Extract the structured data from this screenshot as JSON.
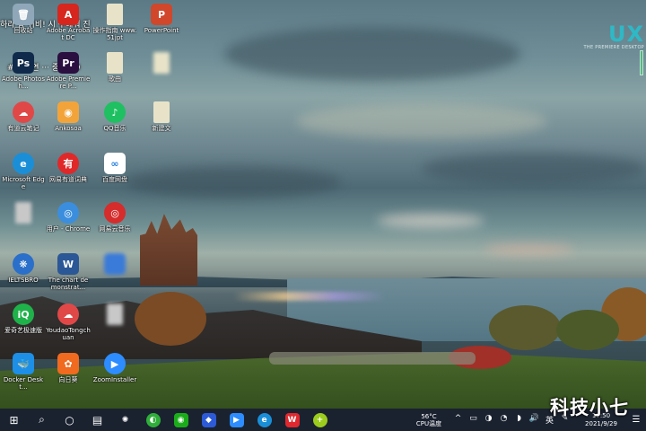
{
  "watermark": {
    "brand": "UX",
    "tagline": "THE PREMIERE DESKTOP",
    "corner_text": "科技小七"
  },
  "overlay": {
    "line1": "하라 왕 쉬비! 시 구해줘 진",
    "line2": "# 8화 연 ··· 중 UHD"
  },
  "icons": [
    {
      "name": "recycle-bin",
      "label": "回收站",
      "glyph": "🗑",
      "color": "#8fa7b8"
    },
    {
      "name": "adobe-acrobat",
      "label": "Adobe Acrobat DC",
      "glyph": "A",
      "color": "#d7261e"
    },
    {
      "name": "file-51jpt",
      "label": "操作指南 www.51jpt",
      "glyph": "",
      "color": "#e8e3c8"
    },
    {
      "name": "powerpoint",
      "label": "PowerPoint",
      "glyph": "P",
      "color": "#d0472b"
    },
    {
      "name": "photoshop",
      "label": "Adobe Photosh...",
      "glyph": "Ps",
      "color": "#0f2a4a"
    },
    {
      "name": "premiere",
      "label": "Adobe Premiere P...",
      "glyph": "Pr",
      "color": "#2a0f40"
    },
    {
      "name": "file-2",
      "label": "歌曲",
      "glyph": "",
      "color": "#e8e3c8"
    },
    {
      "name": "file-3",
      "label": "",
      "glyph": "",
      "color": "#e8e3c8"
    },
    {
      "name": "cloud-app",
      "label": "有道云笔记",
      "glyph": "☁",
      "color": "#e04848"
    },
    {
      "name": "ankora",
      "label": "Ankosoa",
      "glyph": "◉",
      "color": "#f2a43a"
    },
    {
      "name": "qq-music",
      "label": "QQ音乐",
      "glyph": "♪",
      "color": "#1fc061"
    },
    {
      "name": "file-4",
      "label": "新建文",
      "glyph": "",
      "color": "#e8e3c8"
    },
    {
      "name": "edge",
      "label": "Microsoft Edge",
      "glyph": "e",
      "color": "#1a8fd8"
    },
    {
      "name": "youdao-dict",
      "label": "网易有道词典",
      "glyph": "有",
      "color": "#e02828"
    },
    {
      "name": "baidu-pan",
      "label": "百度网盘",
      "glyph": "∞",
      "color": "#ffffff"
    },
    {
      "name": "file-5",
      "label": "",
      "glyph": "",
      "color": "#c8c8c8"
    },
    {
      "name": "chrome",
      "label": "用户 - Chrome",
      "glyph": "◎",
      "color": "#3b8ede"
    },
    {
      "name": "netease-music",
      "label": "网易云音乐",
      "glyph": "◎",
      "color": "#d62c2c"
    },
    {
      "name": "ieltsbro",
      "label": "IELTSBRO",
      "glyph": "❋",
      "color": "#2a6fc9"
    },
    {
      "name": "word-demo",
      "label": "The chart demonstrat...",
      "glyph": "W",
      "color": "#2b5797"
    },
    {
      "name": "blur-app",
      "label": "",
      "glyph": "",
      "color": "#3a7ad8"
    },
    {
      "name": "iqiyi",
      "label": "爱奇艺极速版",
      "glyph": "iQ",
      "color": "#1fb24a"
    },
    {
      "name": "youdao-tongchuan",
      "label": "YoudaoTongchuan",
      "glyph": "☁",
      "color": "#e04848"
    },
    {
      "name": "file-6",
      "label": "",
      "glyph": "",
      "color": "#c8c8c8"
    },
    {
      "name": "docker",
      "label": "Docker Deskt...",
      "glyph": "🐳",
      "color": "#1d8fe6"
    },
    {
      "name": "xiangrikui",
      "label": "向日葵",
      "glyph": "✿",
      "color": "#f06a1f"
    },
    {
      "name": "zoom",
      "label": "ZoomInstaller",
      "glyph": "▶",
      "color": "#2d8cff"
    }
  ],
  "taskbar": {
    "start_glyph": "⊞",
    "search_glyph": "⌕",
    "cortana_glyph": "○",
    "taskview_glyph": "▤",
    "apps": [
      {
        "name": "pinwheel-app",
        "glyph": "✺",
        "color": "#1a2230"
      },
      {
        "name": "green-app",
        "glyph": "◐",
        "color": "#2fae3a"
      },
      {
        "name": "wechat",
        "glyph": "◉",
        "color": "#1aad19"
      },
      {
        "name": "blue-app",
        "glyph": "◆",
        "color": "#2d5bd8"
      },
      {
        "name": "zoom",
        "glyph": "▶",
        "color": "#2d8cff"
      },
      {
        "name": "edge",
        "glyph": "e",
        "color": "#1a8fd8"
      },
      {
        "name": "wps",
        "glyph": "W",
        "color": "#e0282e"
      },
      {
        "name": "plus-app",
        "glyph": "+",
        "color": "#9ccc1c"
      }
    ],
    "cpu_temp": "56°C",
    "cpu_label": "CPU温度",
    "tray": [
      "^",
      "▭",
      "◑",
      "◔",
      "◗",
      "🔊",
      "英",
      "✎"
    ],
    "time": "17:50",
    "date": "2021/9/29",
    "notification_glyph": "☰"
  }
}
